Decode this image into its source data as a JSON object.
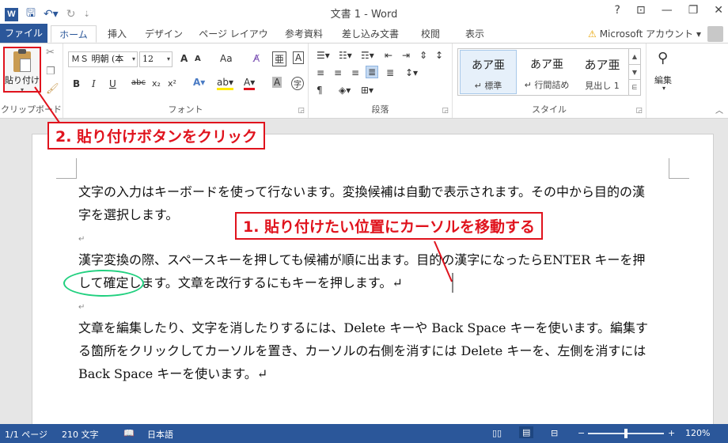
{
  "app": {
    "title": "文書 1 - Word",
    "logo": "W"
  },
  "quick_access": {
    "icons": [
      "word-logo-icon",
      "save-icon",
      "undo-icon",
      "redo-icon",
      "customize-icon"
    ]
  },
  "window_controls": {
    "help": "?",
    "ribbon_display": "⊡",
    "minimize": "—",
    "maximize": "❐",
    "close": "✕"
  },
  "tabs": {
    "file": "ファイル",
    "home": "ホーム",
    "insert": "挿入",
    "design": "デザイン",
    "layout": "ページ レイアウト",
    "references": "参考資料",
    "mailings": "差し込み文書",
    "review": "校閲",
    "view": "表示"
  },
  "account": {
    "label": "Microsoft アカウント",
    "arrow": "▾"
  },
  "ribbon": {
    "clipboard": {
      "paste_label": "貼り付け",
      "group_label": "クリップボード"
    },
    "font": {
      "font_name": "ＭＳ 明朝 (本",
      "font_size": "12",
      "group_label": "フォント",
      "grow": "A",
      "shrink": "A",
      "change_case": "Aa",
      "bold": "B",
      "italic": "I",
      "underline": "U",
      "strikethrough": "abc",
      "subscript": "x₂",
      "superscript": "x²"
    },
    "paragraph": {
      "group_label": "段落"
    },
    "styles": {
      "group_label": "スタイル",
      "items": [
        {
          "sample": "あア亜",
          "name": "↵ 標準"
        },
        {
          "sample": "あア亜",
          "name": "↵ 行間詰め"
        },
        {
          "sample": "あア亜",
          "name": "見出し 1"
        }
      ]
    },
    "editing": {
      "label": "編集"
    }
  },
  "document": {
    "paragraphs": [
      "文字の入力はキーボードを使って行ないます。変換候補は自動で表示されます。その中から目的の漢字を選択します。",
      "漢字変換の際、スペースキーを押しても候補が順に出ます。目的の漢字になったらENTER キーを押して確定します。文章を改行するにもキーを押します。↵",
      "文章を編集したり、文字を消したりするには、Delete キーや Back Space キーを使います。編集する箇所をクリックしてカーソルを置き、カーソルの右側を消すには Delete キーを、左側を消すには Back Space キーを使います。↵"
    ],
    "paragraph_mark": "↵"
  },
  "annotations": {
    "callout_paste": "2. 貼り付けボタンをクリック",
    "callout_cursor": "1. 貼り付けたい位置にカーソルを移動する",
    "colors": {
      "callout": "#e0131d",
      "ellipse": "#21d07f"
    }
  },
  "status_bar": {
    "page": "1/1 ページ",
    "words": "210 文字",
    "language": "日本語",
    "zoom_minus": "−",
    "zoom_plus": "+",
    "zoom": "120%",
    "zoom_fraction": 0.5
  },
  "colors": {
    "accent": "#2b579a"
  }
}
